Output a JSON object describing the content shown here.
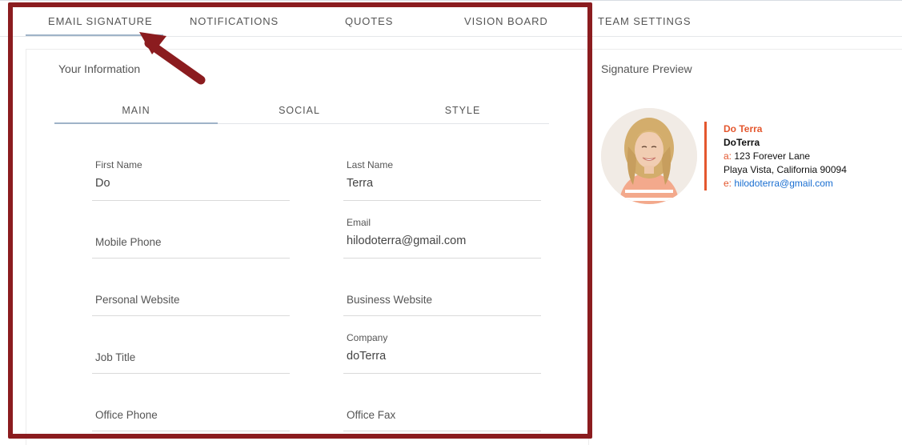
{
  "top_tabs": [
    {
      "label": "EMAIL SIGNATURE",
      "active": true
    },
    {
      "label": "NOTIFICATIONS",
      "active": false
    },
    {
      "label": "QUOTES",
      "active": false
    },
    {
      "label": "VISION BOARD",
      "active": false
    },
    {
      "label": "TEAM SETTINGS",
      "active": false
    }
  ],
  "info": {
    "title": "Your Information",
    "sub_tabs": [
      {
        "label": "MAIN",
        "active": true
      },
      {
        "label": "SOCIAL",
        "active": false
      },
      {
        "label": "STYLE",
        "active": false
      }
    ],
    "fields": {
      "first_name": {
        "label": "First Name",
        "value": "Do"
      },
      "last_name": {
        "label": "Last Name",
        "value": "Terra"
      },
      "mobile_phone": {
        "label": "Mobile Phone",
        "value": ""
      },
      "email": {
        "label": "Email",
        "value": "hilodoterra@gmail.com"
      },
      "personal_website": {
        "label": "Personal Website",
        "value": ""
      },
      "business_website": {
        "label": "Business Website",
        "value": ""
      },
      "job_title": {
        "label": "Job Title",
        "value": ""
      },
      "company": {
        "label": "Company",
        "value": "doTerra"
      },
      "office_phone": {
        "label": "Office Phone",
        "value": ""
      },
      "office_fax": {
        "label": "Office Fax",
        "value": ""
      }
    }
  },
  "preview": {
    "title": "Signature Preview",
    "name": "Do Terra",
    "company": "DoTerra",
    "address_prefix": "a:",
    "address_line1": "123 Forever Lane",
    "address_line2": "Playa Vista, California 90094",
    "email_prefix": "e:",
    "email": "hilodoterra@gmail.com"
  },
  "colors": {
    "accent": "#e4572e",
    "link": "#1a6fd1",
    "highlight_frame": "#8b1c1f",
    "tab_underline": "#9fb3c8"
  },
  "annotation": {
    "arrow_icon": "arrow-pointer-icon"
  }
}
